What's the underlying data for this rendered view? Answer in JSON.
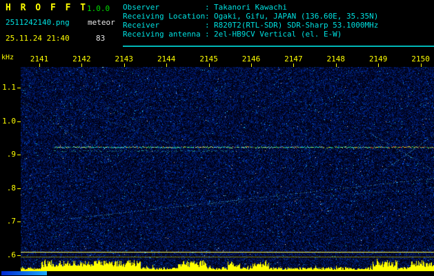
{
  "header": {
    "app_name": "H R O F F T",
    "version": "1.0.0",
    "filename": "2511242140.png",
    "mode": "meteor",
    "datetime": "25.11.24 21:40",
    "count": "83",
    "info_rows": [
      {
        "label": "Observer",
        "value": "Takanori Kawachi"
      },
      {
        "label": "Receiving Location",
        "value": "Ogaki, Gifu, JAPAN (136.60E, 35.35N)"
      },
      {
        "label": "Receiver",
        "value": "R820T2(RTL-SDR) SDR-Sharp 53.1000MHz"
      },
      {
        "label": "Receiving antenna",
        "value": "2el-HB9CV Vertical (el. E-W)"
      }
    ]
  },
  "colors": {
    "accent_yellow": "#ffff00",
    "accent_green": "#00dd00",
    "accent_cyan": "#00e0e0",
    "text_white": "#e8e8e8",
    "separator_cyan": "#00b8b8",
    "noise_floor": "#000020",
    "carrier_red": "#ff4522",
    "amplitude_bar": "#ffff00"
  },
  "chart_data": {
    "type": "heatmap",
    "title": "HROFFT 10-minute radio meteor spectrogram",
    "x_unit": "HHMM",
    "x_ticks": [
      "2141",
      "2142",
      "2143",
      "2144",
      "2145",
      "2146",
      "2147",
      "2148",
      "2149",
      "2150"
    ],
    "y_unit": "kHz",
    "y_ticks": [
      {
        "label": "1.1",
        "khz": 1.1
      },
      {
        "label": "1.0",
        "khz": 1.0
      },
      {
        "label": ".9",
        "khz": 0.9
      },
      {
        "label": ".8",
        "khz": 0.8
      },
      {
        "label": ".7",
        "khz": 0.7
      },
      {
        "label": ".6",
        "khz": 0.6
      }
    ],
    "ylim_khz": [
      0.553,
      1.162
    ],
    "grid": false,
    "legend": false,
    "carrier_line": {
      "freq_khz": 0.923,
      "start_frac": 0.08,
      "red_zone_frac": 0.84
    },
    "secondary_trace": {
      "freq_khz": 0.912,
      "start_frac": 0.08,
      "end_frac": 0.5
    },
    "streaks": [
      [
        0.005,
        0.172,
        0.217,
        0.456,
        0.3
      ],
      [
        0.097,
        0.179,
        0.387,
        0.392,
        0.25
      ],
      [
        0.2,
        0.179,
        0.334,
        0.314,
        0.2
      ],
      [
        0.092,
        0.747,
        1.0,
        0.544,
        0.5
      ],
      [
        0.451,
        0.672,
        1.0,
        0.591,
        0.25
      ],
      [
        0.843,
        0.321,
        1.0,
        0.507,
        0.5
      ],
      [
        0.876,
        0.507,
        1.0,
        0.331,
        0.5
      ]
    ],
    "level_lines": [
      {
        "khz": 0.61,
        "color": "#ffff55"
      },
      {
        "khz": 0.596,
        "color": "#808000"
      }
    ],
    "amplitude_bursts": [
      [
        0.05,
        0.29
      ],
      [
        0.38,
        0.45
      ],
      [
        0.5,
        0.53
      ],
      [
        0.56,
        0.6
      ],
      [
        0.85,
        0.91
      ],
      [
        0.94,
        1.0
      ]
    ]
  }
}
